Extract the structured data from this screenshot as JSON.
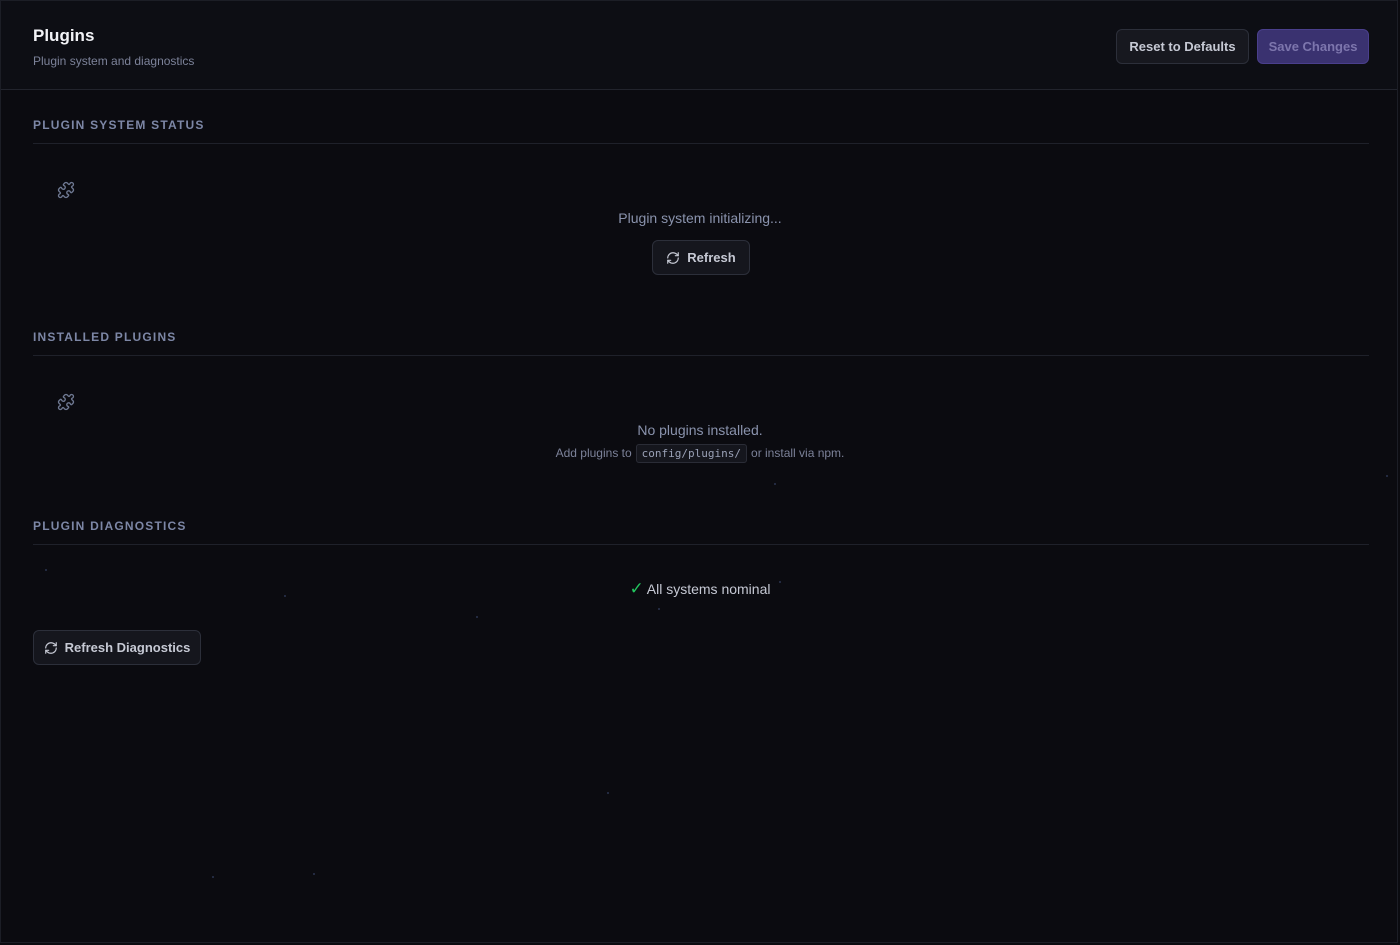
{
  "header": {
    "title": "Plugins",
    "subtitle": "Plugin system and diagnostics",
    "reset_label": "Reset to Defaults",
    "save_label": "Save Changes"
  },
  "system_status": {
    "section_title": "PLUGIN SYSTEM STATUS",
    "message": "Plugin system initializing...",
    "refresh_label": "Refresh"
  },
  "installed": {
    "section_title": "INSTALLED PLUGINS",
    "empty_message": "No plugins installed.",
    "hint_prefix": "Add plugins to",
    "hint_path": "config/plugins/",
    "hint_suffix": "or install via npm."
  },
  "diagnostics": {
    "section_title": "PLUGIN DIAGNOSTICS",
    "check_glyph": "✓",
    "status_message": "All systems nominal",
    "refresh_label": "Refresh Diagnostics"
  },
  "colors": {
    "background": "#0b0b10",
    "accent": "#3a3270",
    "success": "#22c55e"
  },
  "icons": {
    "section_icon": "puzzle-icon",
    "refresh_icon": "refresh-icon"
  }
}
